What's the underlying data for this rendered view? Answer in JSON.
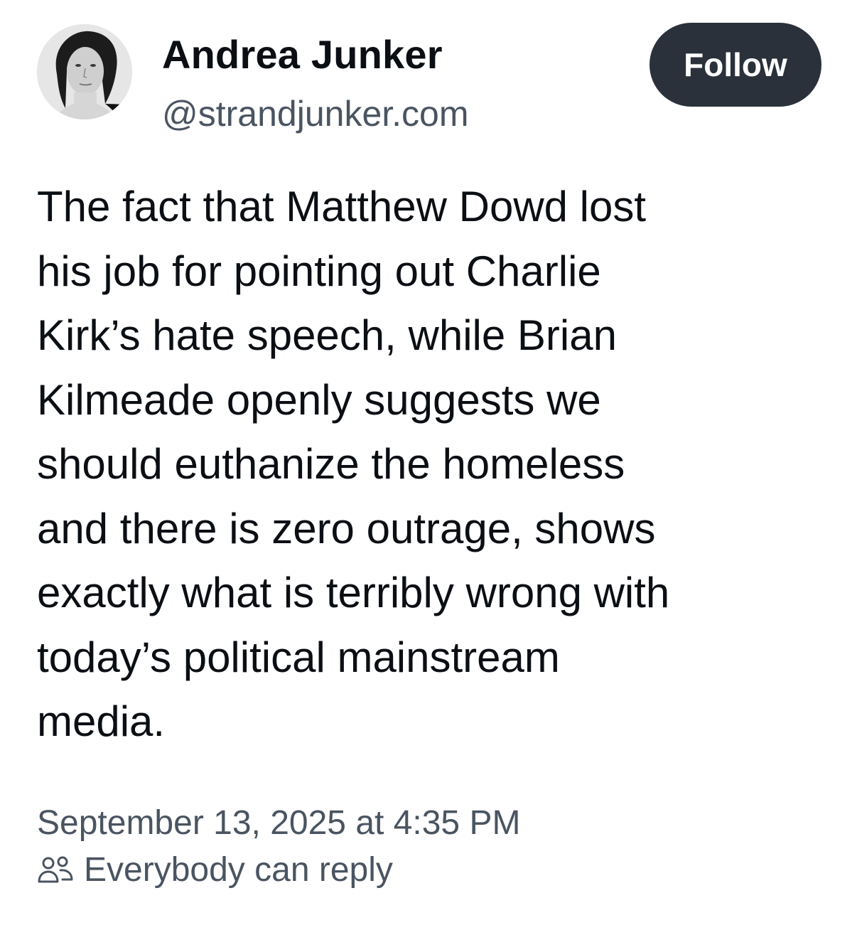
{
  "author": {
    "display_name": "Andrea Junker",
    "handle": "@strandjunker.com",
    "avatar_icon": "profile-photo"
  },
  "follow_button": {
    "label": "Follow",
    "color": "#2a313b"
  },
  "post": {
    "text_lines": [
      "The fact that Matthew Dowd lost",
      "his job for pointing out Charlie",
      "Kirk’s hate speech, while Brian",
      "Kilmeade openly suggests we",
      "should euthanize the homeless",
      "and there is zero outrage, shows",
      "exactly what is terribly wrong with",
      "today’s political mainstream",
      "media."
    ],
    "timestamp": "September 13, 2025 at 4:35 PM",
    "reply_setting": {
      "icon": "people-icon",
      "label": "Everybody can reply"
    }
  },
  "colors": {
    "text": "#0b0f14",
    "secondary_text": "#4a5461",
    "background": "#ffffff"
  }
}
